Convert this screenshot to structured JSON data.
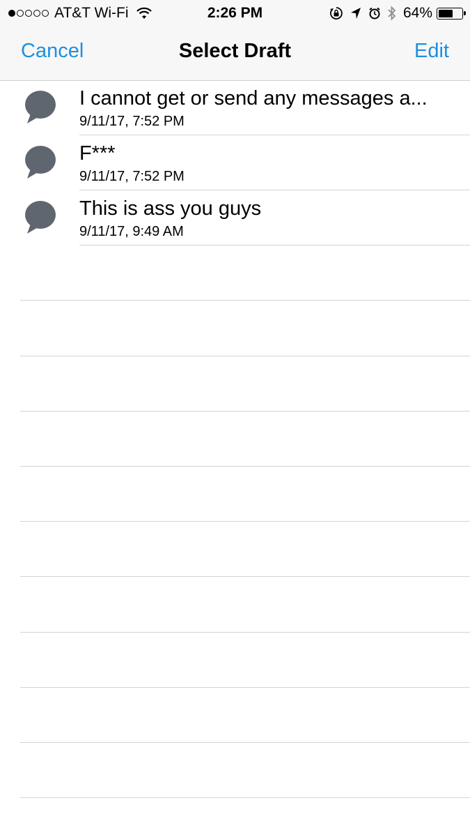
{
  "status_bar": {
    "carrier": "AT&T Wi-Fi",
    "time": "2:26 PM",
    "battery": "64%",
    "battery_level": 0.64,
    "signal_bars_filled": 1,
    "signal_bars_total": 5,
    "icons": [
      "wifi-icon",
      "orientation-lock-icon",
      "location-arrow-icon",
      "alarm-icon",
      "bluetooth-icon",
      "battery-icon"
    ]
  },
  "nav": {
    "cancel": "Cancel",
    "title": "Select Draft",
    "edit": "Edit",
    "accent_color": "#1e8fe0"
  },
  "drafts": [
    {
      "title": "I cannot get or send any messages a...",
      "date": "9/11/17, 7:52 PM",
      "icon": "speech-bubble-icon"
    },
    {
      "title": "F***",
      "date": "9/11/17, 7:52 PM",
      "icon": "speech-bubble-icon"
    },
    {
      "title": "This is ass you guys",
      "date": "9/11/17, 9:49 AM",
      "icon": "speech-bubble-icon"
    }
  ],
  "colors": {
    "bubble": "#5f6670",
    "separator": "#d4d4d8"
  }
}
